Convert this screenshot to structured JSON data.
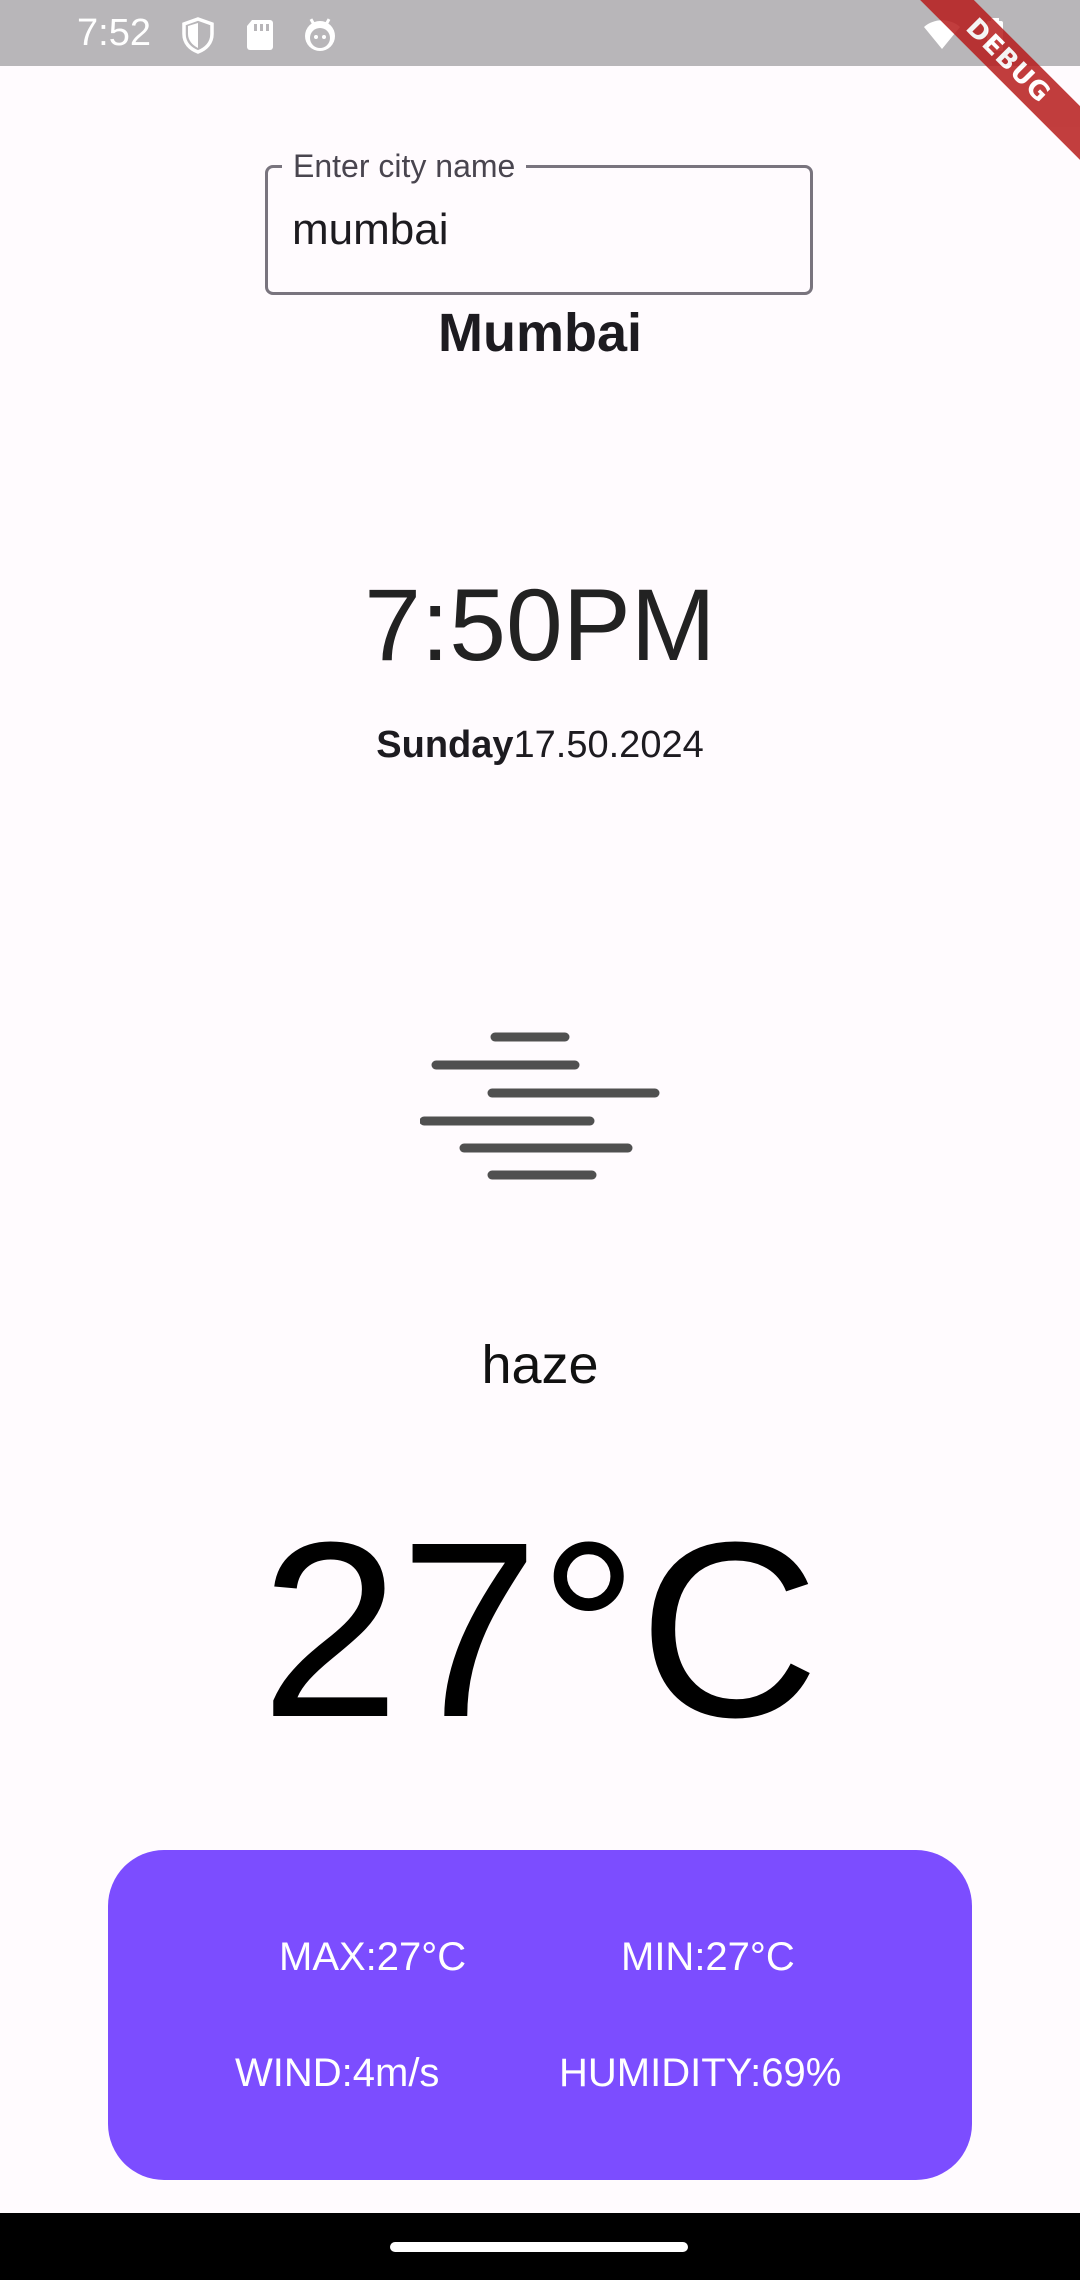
{
  "status_bar": {
    "time": "7:52",
    "icons": [
      "shield-icon",
      "sd-card-icon",
      "android-face-icon",
      "wifi-icon",
      "battery-icon"
    ]
  },
  "debug_banner": "DEBUG",
  "search": {
    "label": "Enter city name",
    "value": "mumbai"
  },
  "city": "Mumbai",
  "time": "7:50PM",
  "date": {
    "day": "Sunday",
    "date": "17.50.2024"
  },
  "weather": {
    "icon": "haze-icon",
    "condition": "haze",
    "temperature": "27°C"
  },
  "details": {
    "max": "MAX:27°C",
    "min": "MIN:27°C",
    "wind": "WIND:4m/s",
    "humidity": "HUMIDITY:69%"
  },
  "colors": {
    "card": "#7c4dff",
    "debug": "#b71c1c"
  }
}
